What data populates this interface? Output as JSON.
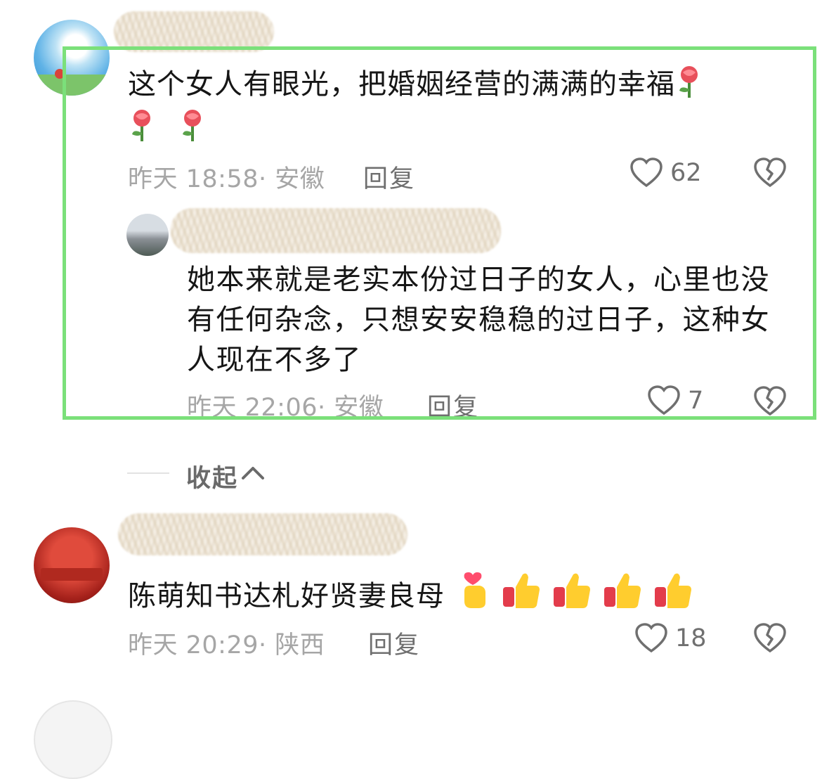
{
  "comments": [
    {
      "text": "这个女人有眼光，把婚姻经营的满满的幸福",
      "meta": "昨天 18:58· 安徽",
      "reply_label": "回复",
      "likes": "62",
      "emoji_after": [
        "rose-emoji",
        "rose-emoji",
        "rose-emoji"
      ]
    },
    {
      "text": "陈萌知书达札好贤妻良母",
      "meta": "昨天 20:29· 陕西",
      "reply_label": "回复",
      "likes": "18",
      "emoji_after": [
        "finger-heart-emoji",
        "thumbs-up-emoji",
        "thumbs-up-emoji",
        "thumbs-up-emoji",
        "thumbs-up-emoji"
      ]
    }
  ],
  "nested_reply": {
    "text": "她本来就是老实本份过日子的女人，心里也没有任何杂念，只想安安稳稳的过日子，这种女人现在不多了",
    "meta": "昨天 22:06· 安徽",
    "reply_label": "回复",
    "likes": "7"
  },
  "collapse": {
    "label": "收起"
  },
  "colors": {
    "highlight_border": "#7be07a",
    "meta_gray": "#a6a6a6"
  }
}
